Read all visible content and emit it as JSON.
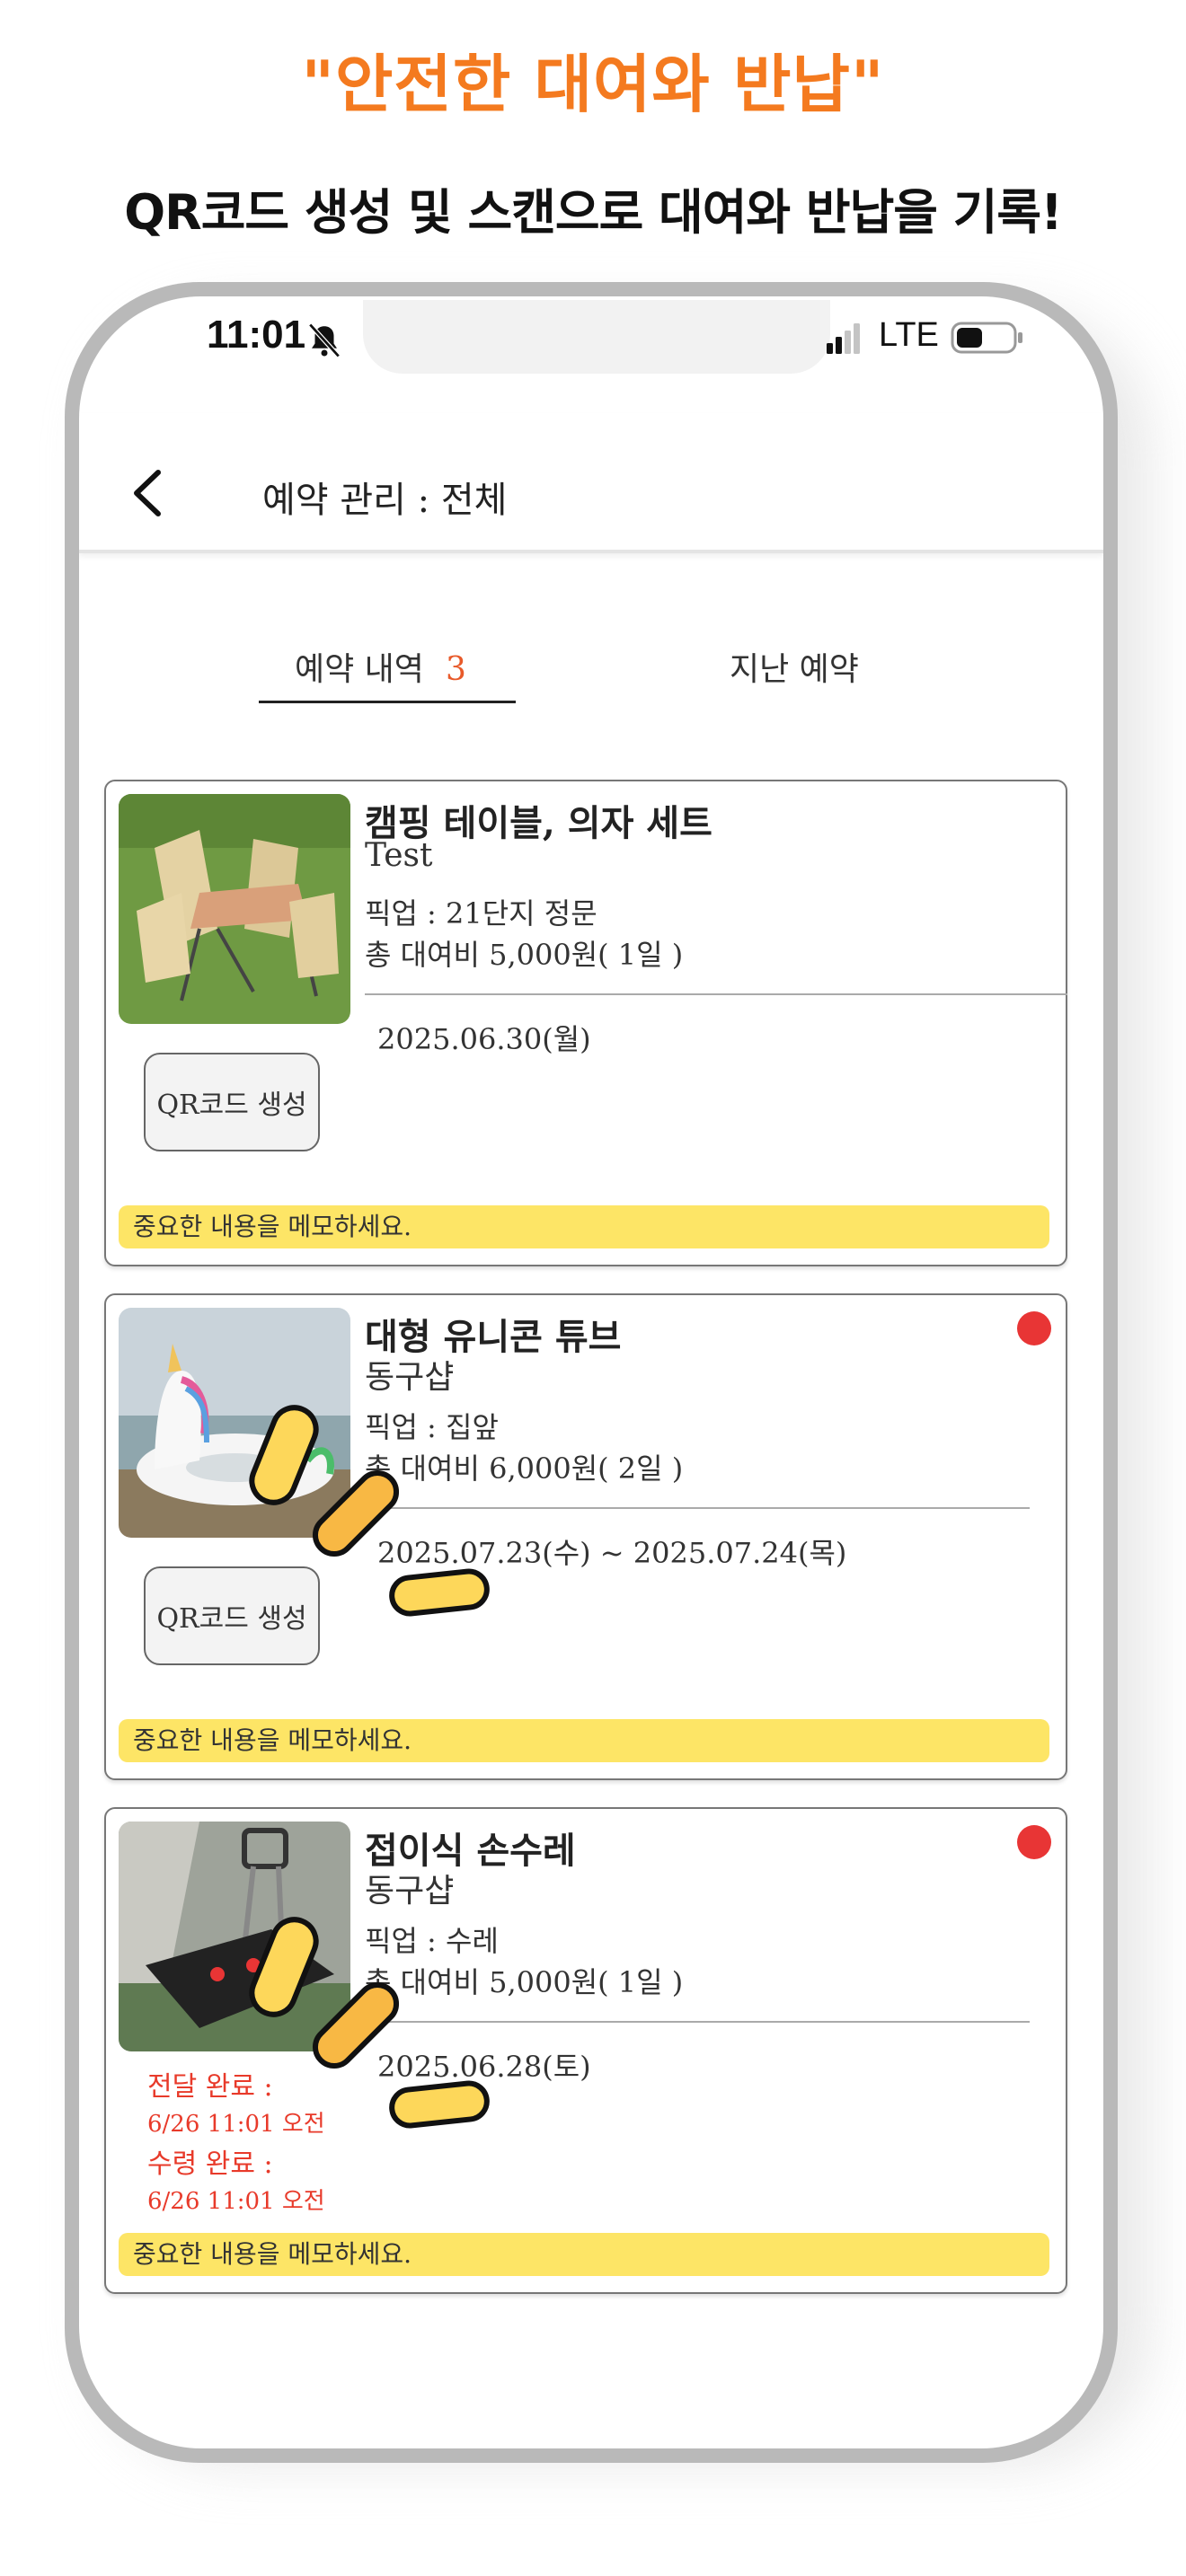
{
  "headline": "\"안전한 대여와 반납\"",
  "subheadline": "QR코드 생성 및 스캔으로 대여와 반납을 기록!",
  "status_bar": {
    "time": "11:01",
    "network": "LTE",
    "icons": [
      "bell-muted-icon",
      "signal-icon",
      "battery-icon"
    ]
  },
  "app_bar": {
    "back_icon": "chevron-left-icon",
    "title": "예약 관리 : 전체"
  },
  "tabs": [
    {
      "label": "예약 내역",
      "count": "3",
      "active": true
    },
    {
      "label": "지난 예약",
      "active": false
    }
  ],
  "reservations": [
    {
      "title": "캠핑 테이블, 의자 세트",
      "owner": "Test",
      "pickup": "픽업 : 21단지 정문",
      "fee": "총 대여비 5,000원( 1일 )",
      "date": "2025.06.30(월)",
      "button_label": "QR코드 생성",
      "memo_placeholder": "중요한 내용을 메모하세요.",
      "new_dot": false
    },
    {
      "title": "대형 유니콘 튜브",
      "owner": "동구샵",
      "pickup": "픽업 : 집앞",
      "fee": "총 대여비 6,000원( 2일 )",
      "date": "2025.07.23(수) ~ 2025.07.24(목)",
      "button_label": "QR코드 생성",
      "memo_placeholder": "중요한 내용을 메모하세요.",
      "new_dot": true
    },
    {
      "title": "접이식 손수레",
      "owner": "동구샵",
      "pickup": "픽업 : 수레",
      "fee": "총 대여비 5,000원( 1일 )",
      "date": "2025.06.28(토)",
      "delivered_label": "전달 완료 :",
      "delivered_time": "6/26 11:01 오전",
      "received_label": "수령 완료 :",
      "received_time": "6/26 11:01 오전",
      "memo_placeholder": "중요한 내용을 메모하세요.",
      "new_dot": true
    }
  ],
  "colors": {
    "headline": "#f47a1f",
    "memo": "#fde566",
    "accent_red": "#e83535",
    "tab_count": "#e85a2a"
  }
}
